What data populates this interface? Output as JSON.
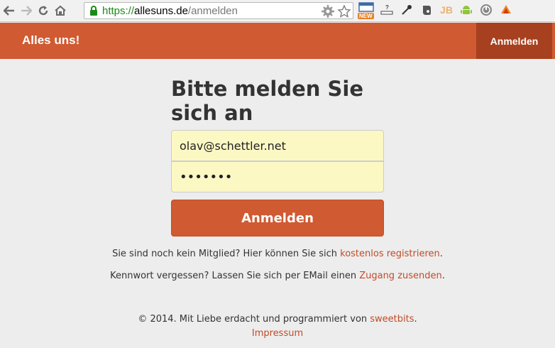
{
  "browser": {
    "url_scheme": "https://",
    "url_host": "allesuns.de",
    "url_path": "/anmelden",
    "ext_new_badge": "NEW",
    "ext_jb": "JB"
  },
  "header": {
    "brand": "Alles uns!",
    "login": "Anmelden"
  },
  "form": {
    "title": "Bitte melden Sie sich an",
    "email_value": "olav@schettler.net",
    "password_value": "•••••••",
    "submit_label": "Anmelden"
  },
  "info": {
    "register_text": "Sie sind noch kein Mitglied? Hier können Sie sich ",
    "register_link": "kostenlos registrieren",
    "register_end": ".",
    "forgot_text": "Kennwort vergessen? Lassen Sie sich per EMail einen ",
    "forgot_link": "Zugang zusenden",
    "forgot_end": "."
  },
  "footer": {
    "copyright_text": "© 2014. Mit Liebe erdacht und programmiert von ",
    "copyright_link": "sweetbits",
    "copyright_end": ".",
    "imprint_link": "Impressum"
  },
  "colors": {
    "accent": "#d05a32",
    "accent_dark": "#a7401f",
    "field_bg": "#fcf8c4",
    "link": "#c24b27"
  }
}
